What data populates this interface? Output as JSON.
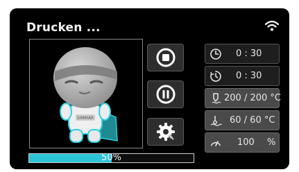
{
  "header": {
    "title": "Drucken ..."
  },
  "status_icons": {
    "wifi": "wifi-icon"
  },
  "preview": {
    "model": "printed-model-thumbnail",
    "label": "SIMMAR"
  },
  "controls": [
    {
      "name": "stop-button",
      "icon": "stop-icon"
    },
    {
      "name": "pause-button",
      "icon": "pause-icon"
    },
    {
      "name": "settings-button",
      "icon": "gear-icon"
    }
  ],
  "info": {
    "print_time": "0 : 30",
    "remaining_time": "0 : 30",
    "nozzle_temp": "200 / 200 °C",
    "bed_temp": "60 / 60 °C",
    "speed_value": "100",
    "speed_unit": "%"
  },
  "progress": {
    "value": 0.5,
    "label": "50%"
  },
  "colors": {
    "accent": "#2cc4d8",
    "background": "#000000",
    "panel": "#1e1e1e"
  }
}
